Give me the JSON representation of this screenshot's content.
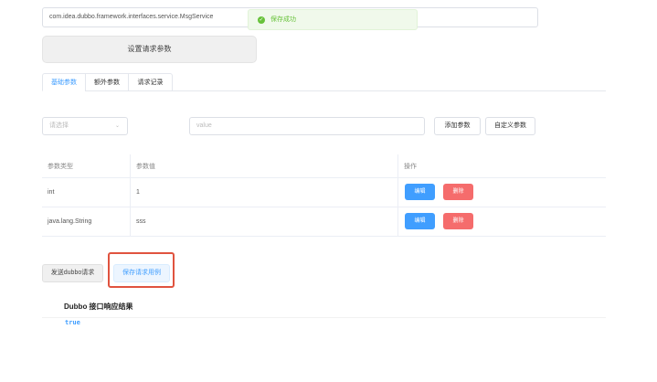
{
  "service": {
    "interface_name": "com.idea.dubbo.framework.interfaces.service.MsgService"
  },
  "toast": {
    "message": "保存成功",
    "icon": "check-circle-icon",
    "color": "#67c23a"
  },
  "set_params_label": "设置请求参数",
  "tabs": [
    {
      "label": "基础参数",
      "active": true
    },
    {
      "label": "额外参数",
      "active": false
    },
    {
      "label": "请求记录",
      "active": false
    }
  ],
  "param_form": {
    "type_placeholder": "请选择",
    "value_placeholder": "value",
    "add_label": "添加参数",
    "custom_label": "自定义参数"
  },
  "table": {
    "headers": [
      "参数类型",
      "参数值",
      "操作"
    ],
    "rows": [
      {
        "type": "int",
        "value": "1",
        "edit": "编辑",
        "delete": "删除"
      },
      {
        "type": "java.lang.String",
        "value": "sss",
        "edit": "编辑",
        "delete": "删除"
      }
    ]
  },
  "actions": {
    "send_label": "发送dubbo请求",
    "save_case_label": "保存请求用例"
  },
  "result": {
    "title": "Dubbo 接口响应结果",
    "value": "true"
  },
  "colors": {
    "primary": "#409eff",
    "danger": "#f56c6c",
    "highlight": "#e0533f"
  }
}
